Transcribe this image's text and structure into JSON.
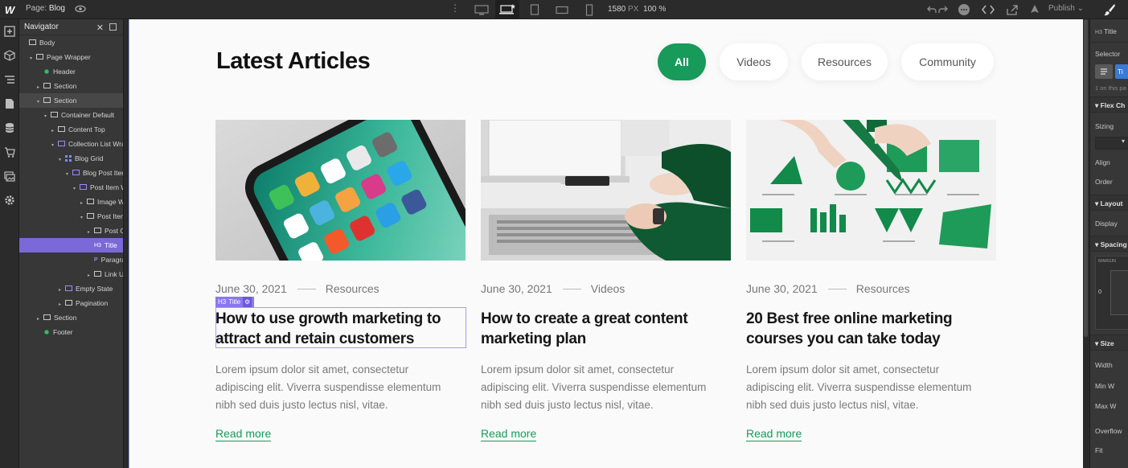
{
  "topbar": {
    "page_prefix": "Page:",
    "page_name": "Blog",
    "width_value": "1580",
    "width_unit": "PX",
    "zoom": "100 %",
    "publish_label": "Publish"
  },
  "navigator": {
    "title": "Navigator",
    "items": [
      {
        "label": "Body",
        "depth": 0,
        "icon": "box",
        "twisty": ""
      },
      {
        "label": "Page Wrapper",
        "depth": 1,
        "icon": "box",
        "twisty": "▾"
      },
      {
        "label": "Header",
        "depth": 2,
        "icon": "component",
        "twisty": ""
      },
      {
        "label": "Section",
        "depth": 2,
        "icon": "section",
        "twisty": "▸"
      },
      {
        "label": "Section",
        "depth": 2,
        "icon": "section",
        "twisty": "▾"
      },
      {
        "label": "Container Default",
        "depth": 3,
        "icon": "container",
        "twisty": "▾"
      },
      {
        "label": "Content Top",
        "depth": 4,
        "icon": "box",
        "twisty": "▸"
      },
      {
        "label": "Collection List Wrap",
        "depth": 4,
        "icon": "collection",
        "twisty": "▾"
      },
      {
        "label": "Blog Grid",
        "depth": 5,
        "icon": "grid",
        "twisty": "▾"
      },
      {
        "label": "Blog Post Item",
        "depth": 6,
        "icon": "collection",
        "twisty": "▾"
      },
      {
        "label": "Post Item W",
        "depth": 7,
        "icon": "link",
        "twisty": "▾"
      },
      {
        "label": "Image Wra",
        "depth": 8,
        "icon": "box",
        "twisty": "▸"
      },
      {
        "label": "Post Item",
        "depth": 8,
        "icon": "box",
        "twisty": "▾"
      },
      {
        "label": "Post Cc",
        "depth": 9,
        "icon": "box",
        "twisty": "▸"
      },
      {
        "label": "Title",
        "depth": 9,
        "icon": "H3",
        "twisty": ""
      },
      {
        "label": "Paragra",
        "depth": 9,
        "icon": "P",
        "twisty": ""
      },
      {
        "label": "Link Un",
        "depth": 9,
        "icon": "box",
        "twisty": "▸"
      },
      {
        "label": "Empty State",
        "depth": 5,
        "icon": "collection",
        "twisty": "▸"
      },
      {
        "label": "Pagination",
        "depth": 5,
        "icon": "box",
        "twisty": "▸"
      },
      {
        "label": "Section",
        "depth": 2,
        "icon": "section",
        "twisty": "▸"
      },
      {
        "label": "Footer",
        "depth": 2,
        "icon": "component",
        "twisty": ""
      }
    ]
  },
  "page": {
    "heading": "Latest Articles",
    "filters": [
      "All",
      "Videos",
      "Resources",
      "Community"
    ],
    "selection_tag": "Title",
    "selection_tag_prefix": "H3",
    "posts": [
      {
        "date": "June 30, 2021",
        "category": "Resources",
        "title": "How to use growth marketing to attract and retain customers",
        "excerpt": "Lorem ipsum dolor sit amet, consectetur adipiscing elit. Viverra suspendisse elementum nibh sed duis justo lectus nisl, vitae.",
        "link": "Read more"
      },
      {
        "date": "June 30, 2021",
        "category": "Videos",
        "title": "How to create a great content marketing plan",
        "excerpt": "Lorem ipsum dolor sit amet, consectetur adipiscing elit. Viverra suspendisse elementum nibh sed duis justo lectus nisl, vitae.",
        "link": "Read more"
      },
      {
        "date": "June 30, 2021",
        "category": "Resources",
        "title": "20 Best free online marketing courses you can take today",
        "excerpt": "Lorem ipsum dolor sit amet, consectetur adipiscing elit. Viverra suspendisse elementum nibh sed duis justo lectus nisl, vitae.",
        "link": "Read more"
      }
    ]
  },
  "style_panel": {
    "element_tag": "H3",
    "element_name": "Title",
    "selector_label": "Selector",
    "selector_chip": "Ti",
    "on_this_page": "1 on this pa",
    "sections": {
      "flex": "Flex Ch",
      "layout": "Layout",
      "spacing": "Spacing",
      "size": "Size"
    },
    "labels": {
      "sizing": "Sizing",
      "align": "Align",
      "order": "Order",
      "display": "Display",
      "margin": "MARGIN",
      "zero": "0",
      "width": "Width",
      "min_w": "Min W",
      "max_w": "Max W",
      "overflow": "Overflow",
      "fit": "Fit"
    }
  },
  "colors": {
    "accent_green": "#179a5a",
    "selection_purple": "#8a76ef",
    "editor_bg": "#2b2b2b",
    "panel_bg": "#373737"
  }
}
